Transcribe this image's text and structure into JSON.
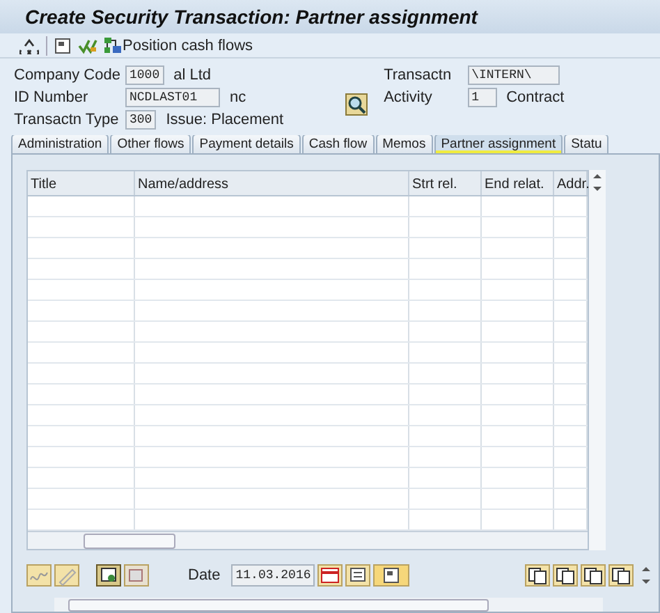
{
  "window": {
    "title": "Create Security Transaction: Partner assignment"
  },
  "toolbar": {
    "button_label": "Position cash flows"
  },
  "header": {
    "left": [
      {
        "label": "Company Code",
        "value": "1000",
        "description": "al Ltd"
      },
      {
        "label": "ID Number",
        "value": "NCDLAST01",
        "description": "nc"
      },
      {
        "label": "Transactn Type",
        "value": "300",
        "description": "Issue: Placement"
      }
    ],
    "right": [
      {
        "label": "Transactn",
        "value": "\\INTERN\\"
      },
      {
        "label": "Activity",
        "value": "1",
        "description": "Contract"
      }
    ]
  },
  "tabs": [
    {
      "label": "Administration",
      "selected": false
    },
    {
      "label": "Other flows",
      "selected": false
    },
    {
      "label": "Payment details",
      "selected": false
    },
    {
      "label": "Cash flow",
      "selected": false
    },
    {
      "label": "Memos",
      "selected": false
    },
    {
      "label": "Partner assignment",
      "selected": true
    },
    {
      "label": "Statu",
      "selected": false
    }
  ],
  "table": {
    "columns": [
      "Title",
      "Name/address",
      "Strt rel.",
      "End relat.",
      "Addr."
    ]
  },
  "footer": {
    "date_label": "Date",
    "date_value": "11.03.2016"
  }
}
